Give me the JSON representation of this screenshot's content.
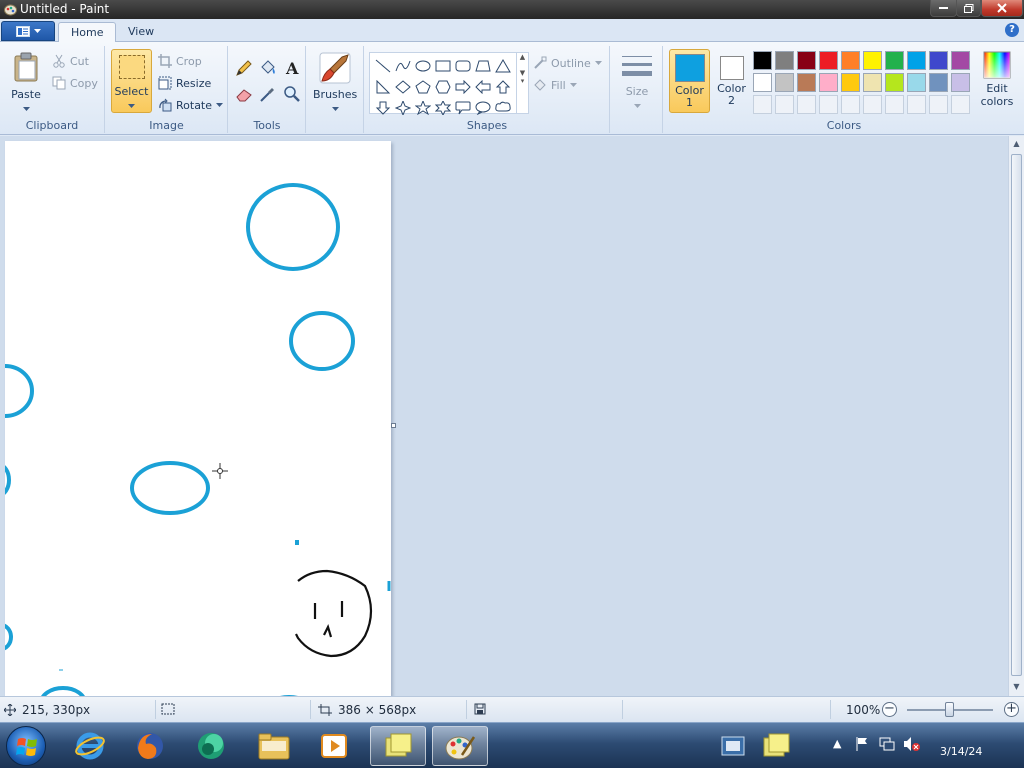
{
  "window": {
    "title": "Untitled - Paint",
    "controls": [
      "minimize",
      "maximize",
      "close"
    ]
  },
  "ribbon_tabs": [
    {
      "label": "Home",
      "selected": true
    },
    {
      "label": "View",
      "selected": false
    }
  ],
  "clipboard": {
    "paste_label": "Paste",
    "cut_label": "Cut",
    "copy_label": "Copy",
    "group_label": "Clipboard"
  },
  "image": {
    "select_label": "Select",
    "crop_label": "Crop",
    "resize_label": "Resize",
    "rotate_label": "Rotate",
    "group_label": "Image"
  },
  "tools": {
    "group_label": "Tools",
    "items": [
      "pencil-icon",
      "fill-icon",
      "text-icon",
      "eraser-icon",
      "color-picker-icon",
      "magnifier-icon"
    ]
  },
  "brushes": {
    "label": "Brushes"
  },
  "shapes": {
    "group_label": "Shapes",
    "outline_label": "Outline",
    "fill_label": "Fill"
  },
  "size": {
    "label": "Size"
  },
  "colors": {
    "group_label": "Colors",
    "color1_label": "Color 1",
    "color2_label": "Color 2",
    "color1": "#0ea0e0",
    "color2": "#ffffff",
    "edit_label": "Edit colors",
    "palette_row1": [
      "#000000",
      "#7f7f7f",
      "#880015",
      "#ed1c24",
      "#ff7f27",
      "#fff200",
      "#22b14c",
      "#00a2e8",
      "#3f48cc",
      "#a349a4"
    ],
    "palette_row2": [
      "#ffffff",
      "#c3c3c3",
      "#b97a57",
      "#ffaec9",
      "#ffc90e",
      "#efe4b0",
      "#b5e61d",
      "#99d9ea",
      "#7092be",
      "#c8bfe7"
    ]
  },
  "status": {
    "cursor_position": "215, 330px",
    "image_size": "386 × 568px",
    "zoom": "100%"
  },
  "taskbar": {
    "apps": [
      "internet-explorer",
      "firefox",
      "app-green",
      "file-explorer",
      "media-player",
      "sticky-notes",
      "paint"
    ],
    "clock_date": "3/14/24"
  }
}
